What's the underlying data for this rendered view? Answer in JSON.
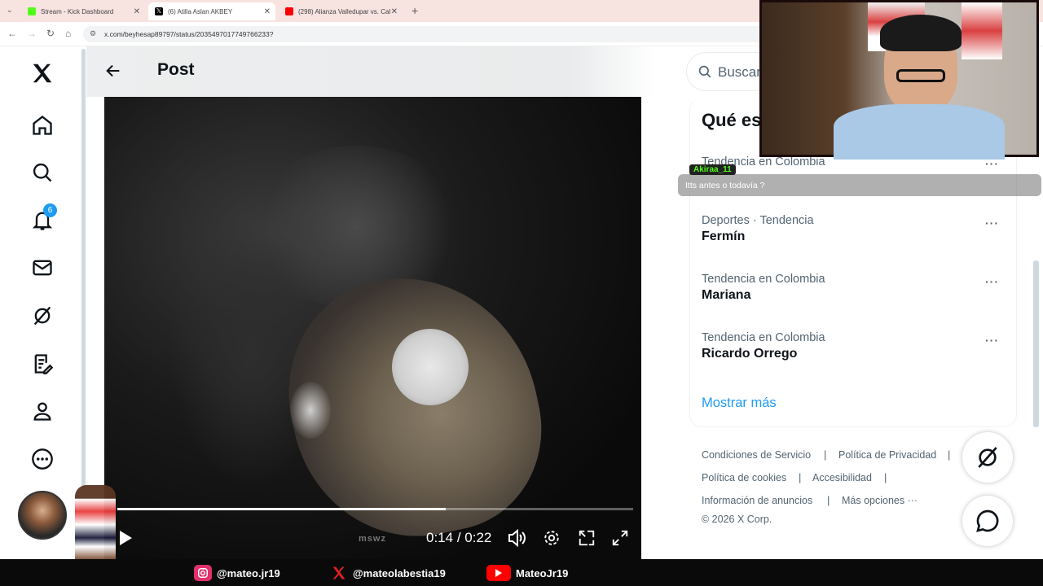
{
  "browser": {
    "tabs": [
      {
        "title": "Stream - Kick Dashboard",
        "favicon_color": "#53fc18"
      },
      {
        "title": "(6) Atilla Aslan AKBEY ",
        "favicon_color": "#000000"
      },
      {
        "title": "(298) Alianza Valledupar vs. Cal",
        "favicon_color": "#ff0000"
      }
    ],
    "url": "x.com/beyhesap89797/status/2035497017749766233?"
  },
  "nav": {
    "notifications_count": "6"
  },
  "post": {
    "title": "Post",
    "video": {
      "current_time": "0:14",
      "duration": "0:22",
      "time_separator": " / ",
      "progress": 0.636,
      "watermark": "mswz"
    }
  },
  "sidebar": {
    "search_placeholder": "Buscar",
    "trends_heading": "Qué es",
    "trends": [
      {
        "context": "Tendencia en Colombia",
        "name": ""
      },
      {
        "context": "Deportes · Tendencia",
        "name": "Fermín"
      },
      {
        "context": "Tendencia en Colombia",
        "name": "Mariana"
      },
      {
        "context": "Tendencia en Colombia",
        "name": "Ricardo Orrego"
      }
    ],
    "show_more": "Mostrar más",
    "footer": {
      "terms": "Condiciones de Servicio",
      "privacy": "Política de Privacidad",
      "cookies": "Política de cookies",
      "accessibility": "Accesibilidad",
      "ads_info": "Información de anuncios",
      "more": "Más opciones ···",
      "copyright": "© 2026 X Corp."
    }
  },
  "stream_overlay": {
    "chat": {
      "user": "Akiraa_11",
      "message": "Itts antes o todavía ?"
    },
    "socials": [
      {
        "platform": "instagram",
        "handle": "@mateo.jr19",
        "color": "#e1306c"
      },
      {
        "platform": "x",
        "handle": "@mateolabestia19",
        "color": "#e02020"
      },
      {
        "platform": "youtube",
        "handle": "MateoJr19",
        "color": "#ff0000"
      }
    ]
  }
}
